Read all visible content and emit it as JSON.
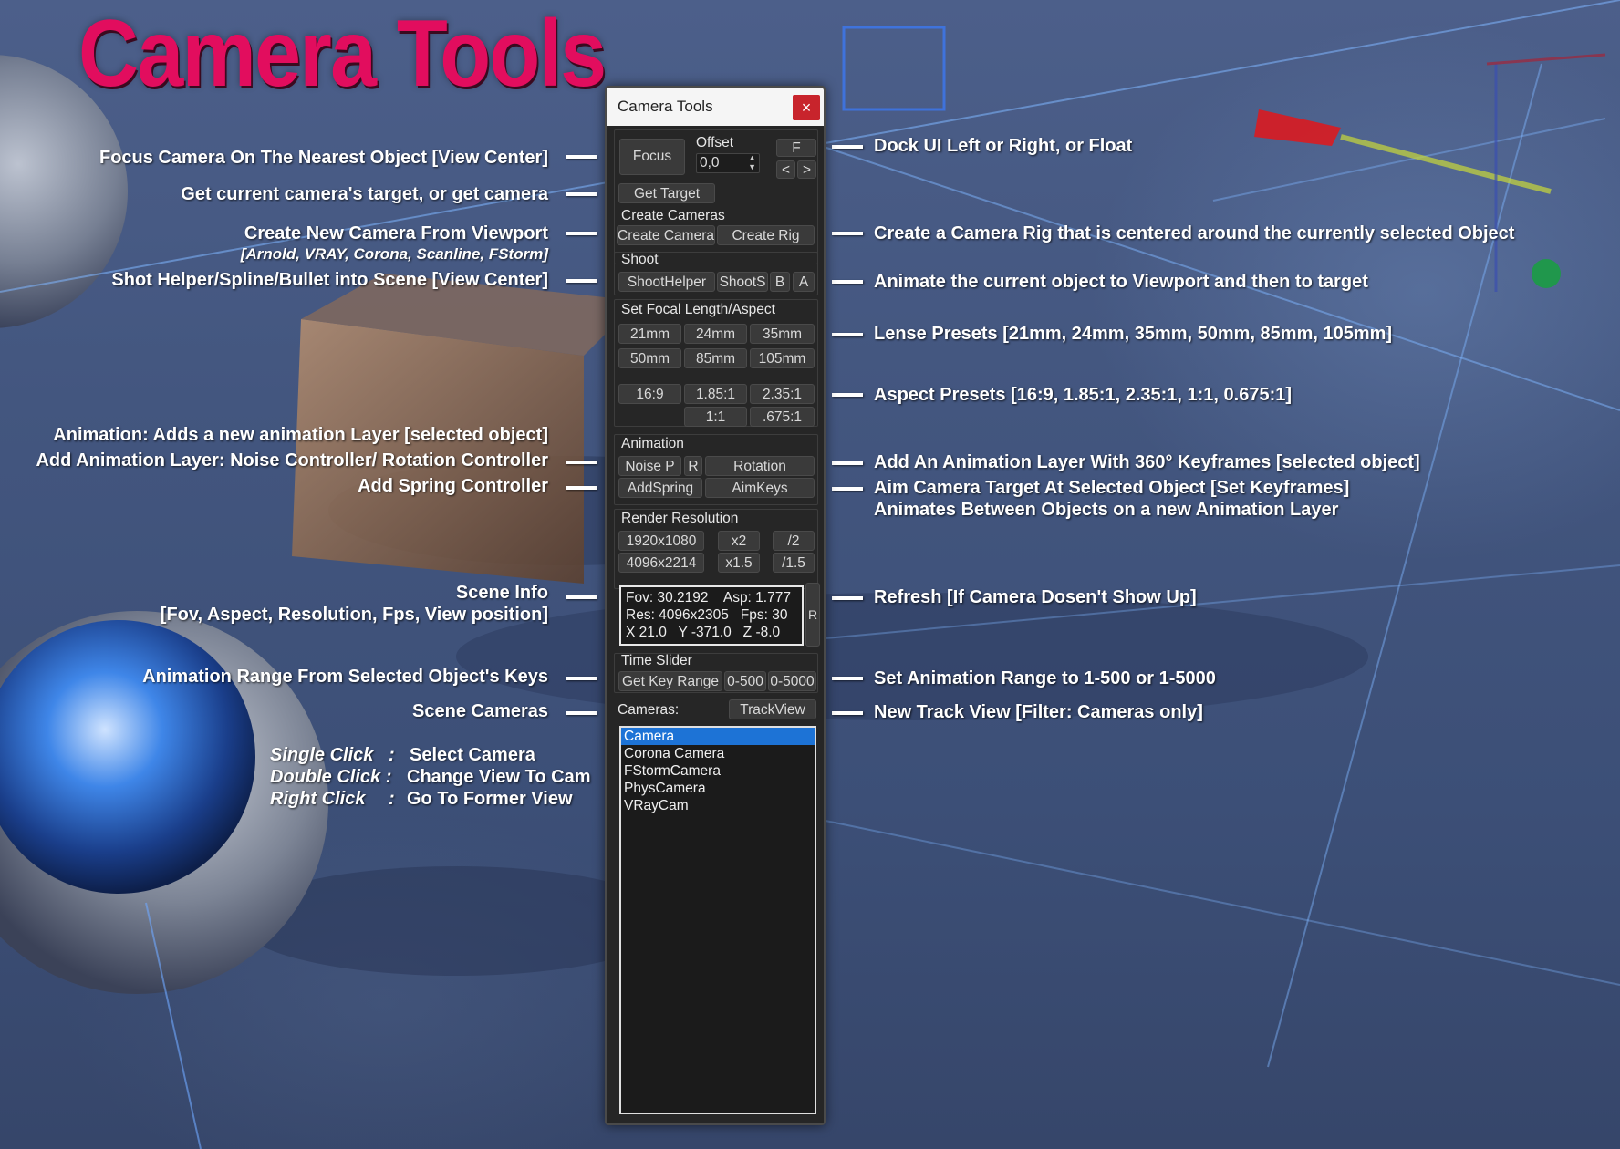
{
  "colors": {
    "title": "#e20d5e",
    "selection": "#1d73d6",
    "close": "#c8242c"
  },
  "banner_title": "Camera Tools",
  "panel": {
    "title": "Camera Tools",
    "close_glyph": "×",
    "focus": "Focus",
    "offset_label": "Offset",
    "offset_value": "0,0",
    "dock_float": "F",
    "dock_left": "<",
    "dock_right": ">",
    "get_target": "Get Target",
    "create_cameras_label": "Create Cameras",
    "create_camera": "Create Camera",
    "create_rig": "Create Rig",
    "shoot_label": "Shoot",
    "shoot_helper": "ShootHelper",
    "shoot_s": "ShootS",
    "shoot_b": "B",
    "shoot_a": "A",
    "focal_label": "Set Focal Length/Aspect",
    "lens": [
      "21mm",
      "24mm",
      "35mm",
      "50mm",
      "85mm",
      "105mm"
    ],
    "aspects": [
      "16:9",
      "1.85:1",
      "2.35:1",
      "1:1",
      ".675:1"
    ],
    "animation_label": "Animation",
    "noise_p": "Noise P",
    "anim_r": "R",
    "rotation": "Rotation",
    "add_spring": "AddSpring",
    "aim_keys": "AimKeys",
    "render_label": "Render Resolution",
    "res1": "1920x1080",
    "res2": "4096x2214",
    "x2": "x2",
    "div2": "/2",
    "x15": "x1.5",
    "div15": "/1.5",
    "info_line1": "Fov: 30.2192    Asp: 1.777",
    "info_line2": "Res: 4096x2305   Fps: 30",
    "info_line3": "X 21.0   Y -371.0   Z -8.0",
    "refresh": "R",
    "time_slider_label": "Time Slider",
    "get_key_range": "Get Key Range",
    "range500": "0-500",
    "range5000": "0-5000",
    "cameras_label": "Cameras:",
    "trackview": "TrackView",
    "cameras": [
      "Camera",
      "Corona Camera",
      "FStormCamera",
      "PhysCamera",
      "VRayCam"
    ]
  },
  "annotations_left": {
    "focus": "Focus Camera On The Nearest Object [View Center]",
    "get_target": "Get current camera's target, or get camera",
    "create_camera": "Create New Camera From Viewport",
    "create_camera_sub": "[Arnold, VRAY, Corona, Scanline, FStorm]",
    "shoot": "Shot Helper/Spline/Bullet into Scene [View Center]",
    "animation": "Animation: Adds a new animation Layer [selected object]",
    "noise": "Add Animation Layer: Noise Controller/ Rotation Controller",
    "spring": "Add Spring Controller",
    "scene_info": "Scene Info",
    "scene_info_sub": "[Fov, Aspect, Resolution, Fps, View position]",
    "anim_range": "Animation Range From Selected Object's Keys",
    "scene_cameras": "Scene Cameras"
  },
  "annotations_right": {
    "dock": "Dock UI Left or Right, or Float",
    "rig": "Create a Camera Rig that is centered around the currently selected Object",
    "animate": "Animate the current object to Viewport and then to target",
    "lense": "Lense Presets [21mm, 24mm, 35mm, 50mm, 85mm, 105mm]",
    "aspect": "Aspect Presets  [16:9, 1.85:1, 2.35:1, 1:1, 0.675:1]",
    "rotation": "Add An Animation Layer With 360° Keyframes [selected object]",
    "aim": "Aim Camera Target At Selected Object [Set Keyframes]",
    "aim2": "Animates Between Objects on a new Animation Layer",
    "refresh": "Refresh [If Camera Dosen't Show Up]",
    "range": "Set Animation Range to 1-500 or 1-5000",
    "trackview": "New Track View  [Filter: Cameras only]"
  },
  "click_help": {
    "single_key": "Single Click",
    "single_sep": ":",
    "single_val": "Select Camera",
    "double_key": "Double Click :",
    "double_val": "Change View To Cam",
    "right_key": "Right Click",
    "right_sep": ":",
    "right_val": "Go To Former View"
  }
}
